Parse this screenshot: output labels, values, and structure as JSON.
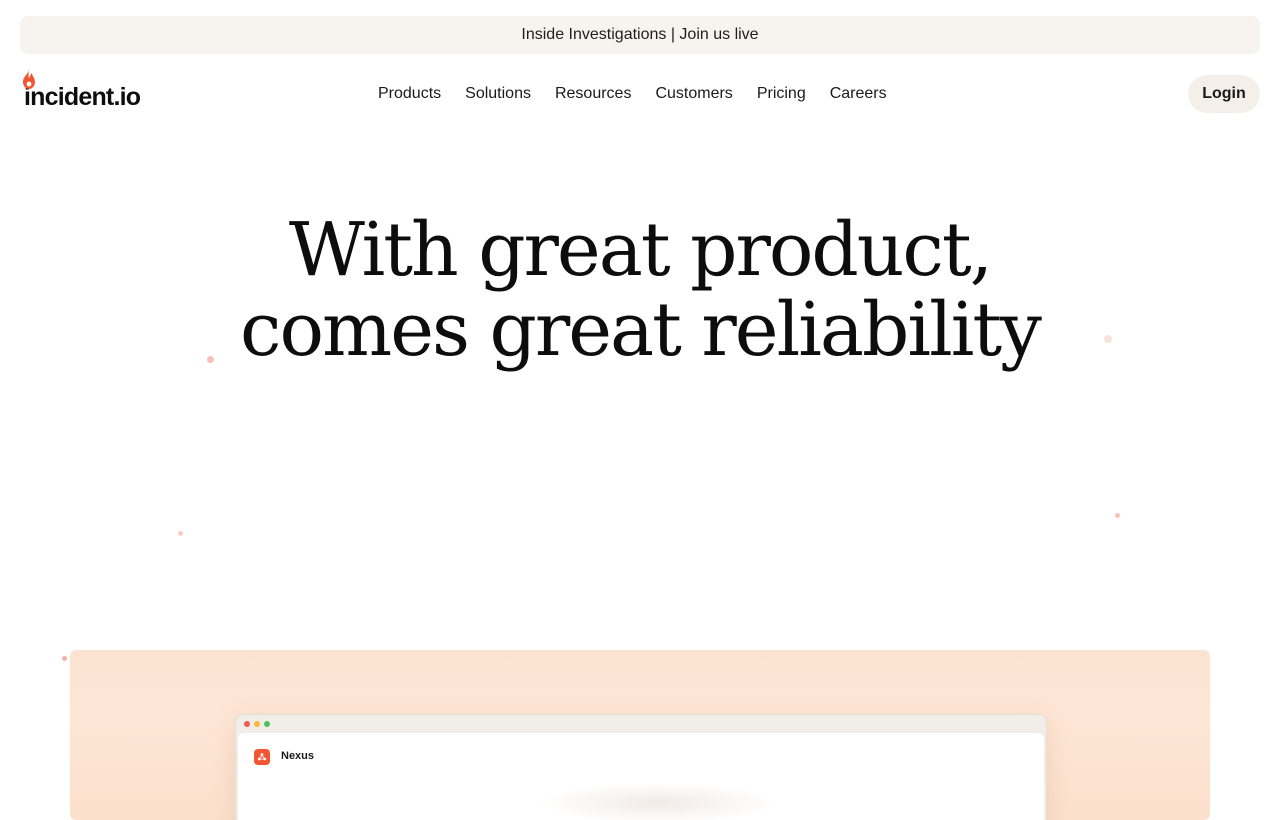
{
  "banner": {
    "text": "Inside Investigations | Join us live"
  },
  "header": {
    "logo_text": "incident.io",
    "nav": [
      {
        "label": "Products"
      },
      {
        "label": "Solutions"
      },
      {
        "label": "Resources"
      },
      {
        "label": "Customers"
      },
      {
        "label": "Pricing"
      },
      {
        "label": "Careers"
      }
    ],
    "login_label": "Login"
  },
  "hero": {
    "title_line1": "With great product,",
    "title_line2": "comes great reliability"
  },
  "showcase": {
    "app_name": "Nexus"
  },
  "colors": {
    "brand": "#f25533",
    "banner_bg": "#f7f3ee",
    "login_bg": "#f4efe9",
    "showcase_bg": "#fbe3d2"
  }
}
